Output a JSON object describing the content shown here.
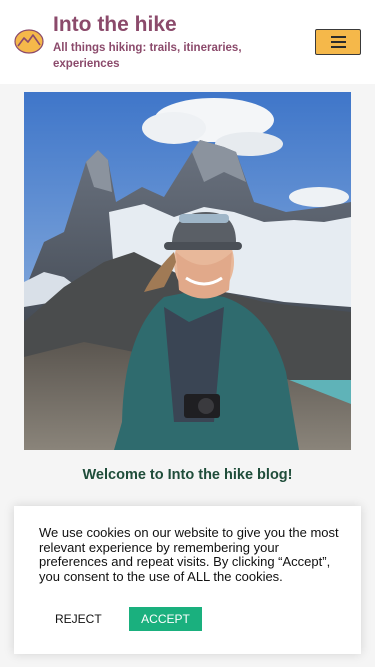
{
  "header": {
    "title": "Into the hike",
    "tagline": "All things hiking: trails, itineraries, experiences",
    "logo_icon": "mountain-logo-icon",
    "menu_icon": "hamburger-menu-icon"
  },
  "hero": {
    "image": "photo of a smiling hiker in a teal jacket and cap in front of jagged snowy mountain peaks"
  },
  "main": {
    "welcome": "Welcome to Into the hike blog!"
  },
  "cookie_banner": {
    "text": "We use cookies on our website to give you the most relevant experience by remembering your preferences and repeat visits. By clicking “Accept”, you consent to the use of ALL the cookies.",
    "reject_label": "REJECT",
    "accept_label": "ACCEPT"
  },
  "colors": {
    "brand": "#8b4a6b",
    "menu_button": "#f5b84a",
    "accept_button": "#1ab07e",
    "welcome_text": "#1f4d3a"
  }
}
